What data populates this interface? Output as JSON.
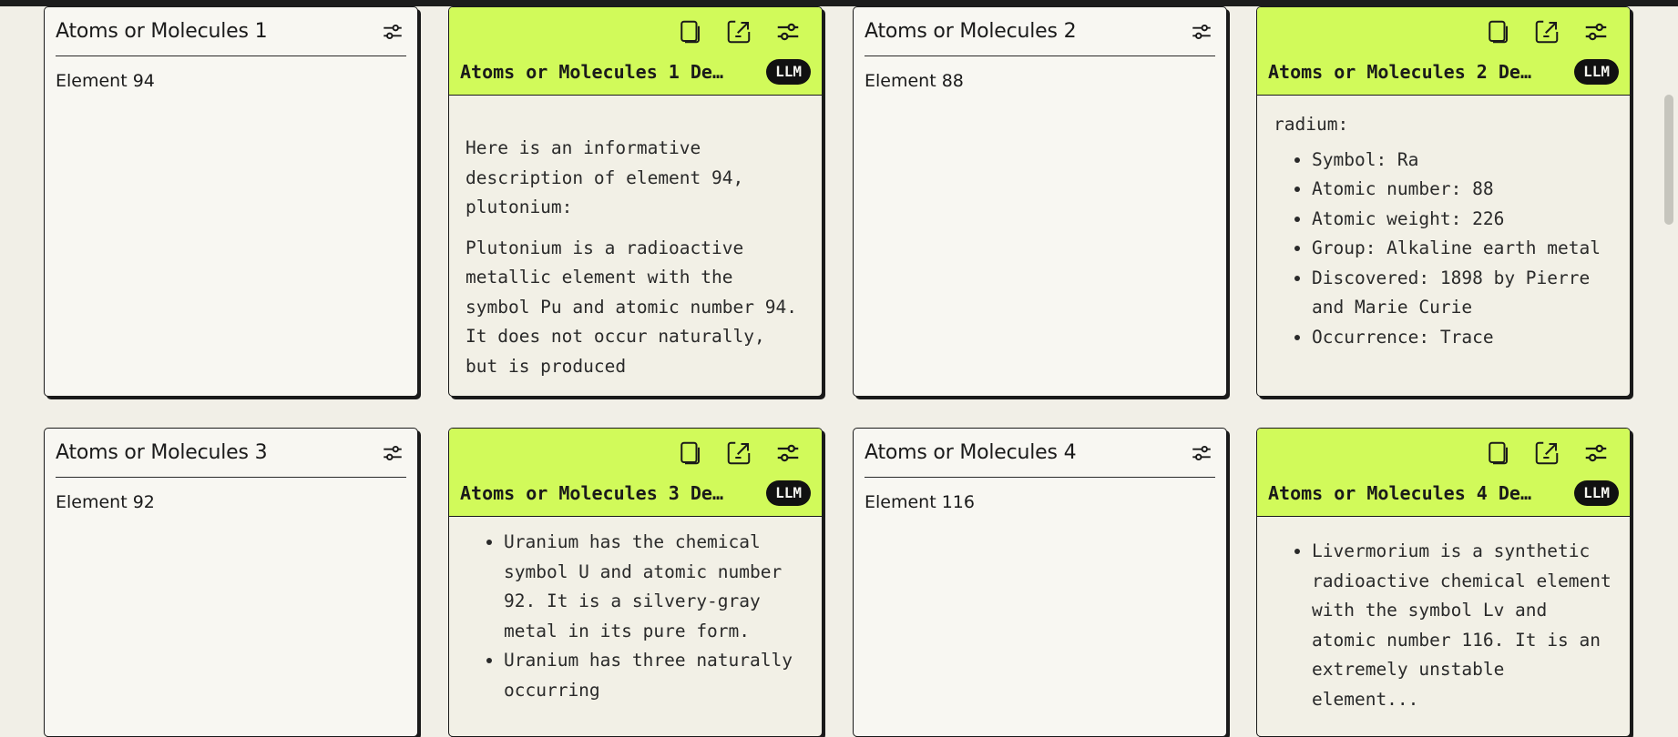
{
  "cards": [
    {
      "title": "Atoms or Molecules 1",
      "value": "Element 94"
    },
    {
      "title": "Atoms or Molecules 2",
      "value": "Element 88"
    },
    {
      "title": "Atoms or Molecules 3",
      "value": "Element 92"
    },
    {
      "title": "Atoms or Molecules 4",
      "value": "Element 116"
    }
  ],
  "outputs": [
    {
      "title": "Atoms or Molecules 1 De…",
      "badge": "LLM",
      "para1": "Here is an informative description of element 94, plutonium:",
      "para2": "Plutonium is a radioactive metallic element with the symbol Pu and atomic number 94. It does not occur naturally, but is produced"
    },
    {
      "title": "Atoms or Molecules 2 De…",
      "badge": "LLM",
      "intro": "radium:",
      "items": [
        "Symbol: Ra",
        "Atomic number: 88",
        "Atomic weight: 226",
        "Group: Alkaline earth metal",
        "Discovered: 1898 by Pierre and Marie Curie",
        "Occurrence: Trace"
      ]
    },
    {
      "title": "Atoms or Molecules 3 De…",
      "badge": "LLM",
      "items": [
        "Uranium has the chemical symbol U and atomic number 92. It is a silvery-gray metal in its pure form.",
        "Uranium has three naturally occurring"
      ]
    },
    {
      "title": "Atoms or Molecules 4 De…",
      "badge": "LLM",
      "items": [
        "Livermorium is a synthetic radioactive chemical element with the symbol Lv and atomic number 116. It is an extremely unstable element..."
      ]
    }
  ],
  "icons": {
    "filter": "sliders-icon",
    "copy": "copy-icon",
    "export": "export-icon"
  },
  "colors": {
    "accent": "#d1fa5a",
    "background": "#f1efe7",
    "card": "#f8f7f2",
    "badge": "#111111"
  }
}
